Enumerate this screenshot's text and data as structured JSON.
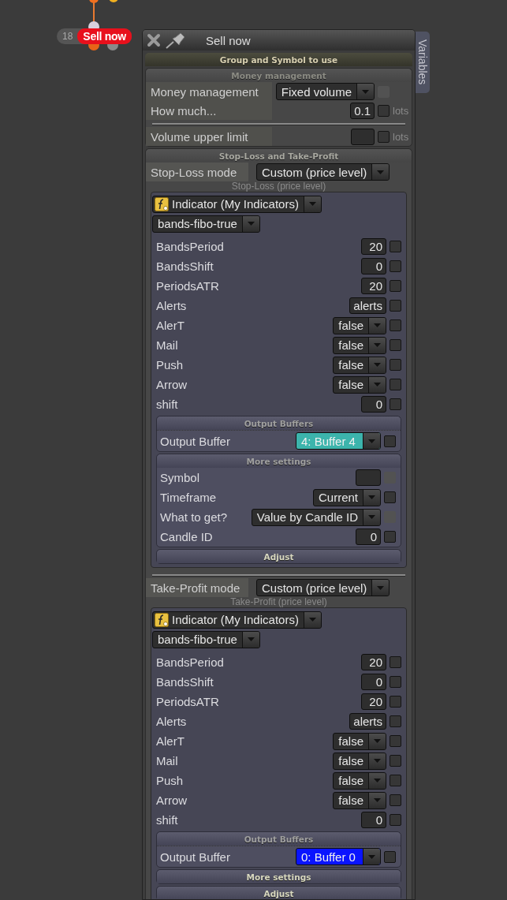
{
  "node": {
    "count": "18",
    "title": "Sell now"
  },
  "window": {
    "title": "Sell now",
    "side_tab": "Variables"
  },
  "group_header": "Group and Symbol to use",
  "money": {
    "header": "Money management",
    "rows": [
      {
        "kind": "select",
        "label": "Money management",
        "value": "Fixed volume",
        "checked": false,
        "check_disabled": true,
        "separated": false
      },
      {
        "kind": "input",
        "label": "How much...",
        "value": "0.1",
        "unit": "lots",
        "checked": false,
        "check_disabled": false,
        "separated": false
      },
      {
        "kind": "input",
        "label": "Volume upper limit",
        "unit": "lots",
        "checked": false,
        "check_disabled": false,
        "separated": true
      }
    ]
  },
  "sltp": {
    "header": "Stop-Loss and Take-Profit",
    "blocks": [
      {
        "mode_label": "Stop-Loss mode",
        "mode_value": "Custom (price level)",
        "caption": "Stop-Loss (price level)",
        "indicator": "Indicator (My Indicators)",
        "indicator_name": "bands-fibo-true",
        "params": [
          {
            "kind": "input",
            "label": "BandsPeriod",
            "value": "20",
            "checked": false
          },
          {
            "kind": "input",
            "label": "BandsShift",
            "value": "0",
            "checked": false
          },
          {
            "kind": "input",
            "label": "PeriodsATR",
            "value": "20",
            "checked": false
          },
          {
            "kind": "input",
            "label": "Alerts",
            "value": "alerts",
            "checked": false
          },
          {
            "kind": "select",
            "label": "AlerT",
            "value": "false",
            "checked": false
          },
          {
            "kind": "select",
            "label": "Mail",
            "value": "false",
            "checked": false
          },
          {
            "kind": "select",
            "label": "Push",
            "value": "false",
            "checked": false
          },
          {
            "kind": "select",
            "label": "Arrow",
            "value": "false",
            "checked": false
          },
          {
            "kind": "input",
            "label": "shift",
            "value": "0",
            "checked": false
          }
        ],
        "output": {
          "header": "Output Buffers",
          "label": "Output Buffer",
          "value": "4: Buffer 4",
          "color": "#3cb4ac",
          "checked": false
        },
        "more": {
          "header": "More settings",
          "expanded": true,
          "rows": [
            {
              "kind": "input",
              "label": "Symbol",
              "checked": false,
              "check_disabled": true
            },
            {
              "kind": "select",
              "label": "Timeframe",
              "value": "Current",
              "checked": false,
              "check_disabled": false
            },
            {
              "kind": "select",
              "label": "What to get?",
              "value": "Value by Candle ID",
              "checked": false,
              "check_disabled": true
            },
            {
              "kind": "input",
              "label": "Candle ID",
              "value": "0",
              "checked": false,
              "check_disabled": false
            }
          ]
        },
        "adjust": "Adjust"
      },
      {
        "mode_label": "Take-Profit mode",
        "mode_value": "Custom (price level)",
        "caption": "Take-Profit (price level)",
        "indicator": "Indicator (My Indicators)",
        "indicator_name": "bands-fibo-true",
        "params": [
          {
            "kind": "input",
            "label": "BandsPeriod",
            "value": "20",
            "checked": false
          },
          {
            "kind": "input",
            "label": "BandsShift",
            "value": "0",
            "checked": false
          },
          {
            "kind": "input",
            "label": "PeriodsATR",
            "value": "20",
            "checked": false
          },
          {
            "kind": "input",
            "label": "Alerts",
            "value": "alerts",
            "checked": false
          },
          {
            "kind": "select",
            "label": "AlerT",
            "value": "false",
            "checked": false
          },
          {
            "kind": "select",
            "label": "Mail",
            "value": "false",
            "checked": false
          },
          {
            "kind": "select",
            "label": "Push",
            "value": "false",
            "checked": false
          },
          {
            "kind": "select",
            "label": "Arrow",
            "value": "false",
            "checked": false
          },
          {
            "kind": "input",
            "label": "shift",
            "value": "0",
            "checked": false
          }
        ],
        "output": {
          "header": "Output Buffers",
          "label": "Output Buffer",
          "value": "0: Buffer 0",
          "color": "#0a14ff",
          "checked": false
        },
        "more": {
          "header": "More settings",
          "expanded": false
        },
        "adjust": "Adjust"
      }
    ]
  }
}
